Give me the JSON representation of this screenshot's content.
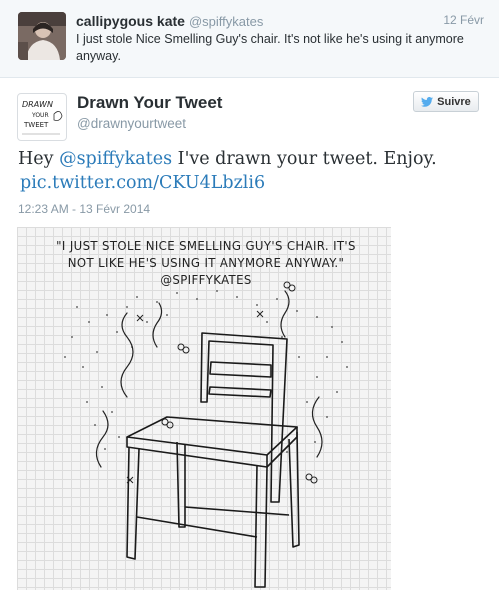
{
  "reply": {
    "name": "callipygous kate",
    "handle": "@spiffykates",
    "date": "12 Févr",
    "text": "I just stole Nice Smelling Guy's chair. It's not like he's using it anymore anyway."
  },
  "tweet": {
    "author_name": "Drawn Your Tweet",
    "author_handle": "@drawnyourtweet",
    "logo_text": [
      "DRAWN",
      "YOUR",
      "TWEET"
    ],
    "follow_label": "Suivre",
    "text_prefix": "Hey ",
    "mention": "@spiffykates",
    "text_suffix": " I've drawn your tweet. Enjoy.",
    "pic_link": "pic.twitter.com/CKU4Lbzli6",
    "timestamp": "12:23 AM - 13 Févr 2014"
  },
  "media": {
    "caption": "\"I JUST STOLE NICE SMELLING GUY'S CHAIR. IT'S NOT LIKE HE'S USING IT ANYMORE ANYWAY.\" @SPIFFYKATES"
  },
  "colors": {
    "link": "#2b7bb9",
    "muted": "#8899a6",
    "text": "#292f33",
    "twitter_bird": "#55acee"
  },
  "icons": {
    "follow": "twitter-bird-icon"
  }
}
